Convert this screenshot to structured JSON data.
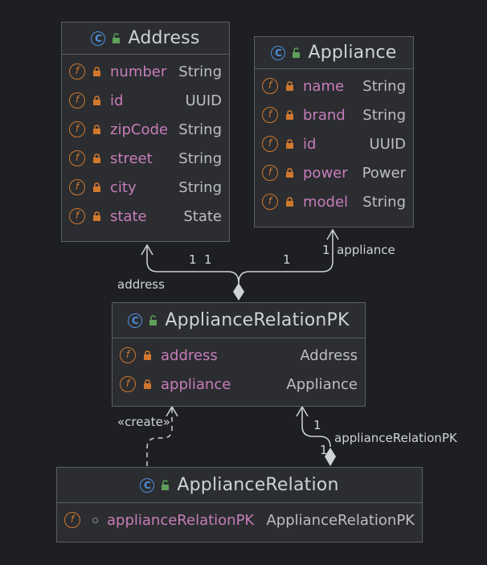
{
  "classes": {
    "address": {
      "name": "Address",
      "fields": [
        {
          "name": "number",
          "type": "String"
        },
        {
          "name": "id",
          "type": "UUID"
        },
        {
          "name": "zipCode",
          "type": "String"
        },
        {
          "name": "street",
          "type": "String"
        },
        {
          "name": "city",
          "type": "String"
        },
        {
          "name": "state",
          "type": "State"
        }
      ]
    },
    "appliance": {
      "name": "Appliance",
      "fields": [
        {
          "name": "name",
          "type": "String"
        },
        {
          "name": "brand",
          "type": "String"
        },
        {
          "name": "id",
          "type": "UUID"
        },
        {
          "name": "power",
          "type": "Power"
        },
        {
          "name": "model",
          "type": "String"
        }
      ]
    },
    "pk": {
      "name": "ApplianceRelationPK",
      "fields": [
        {
          "name": "address",
          "type": "Address"
        },
        {
          "name": "appliance",
          "type": "Appliance"
        }
      ]
    },
    "relation": {
      "name": "ApplianceRelation",
      "fields": [
        {
          "name": "applianceRelationPK",
          "type": "ApplianceRelationPK"
        }
      ]
    }
  },
  "edges": {
    "address_role": "address",
    "address_mult_a": "1",
    "address_mult_b": "1",
    "appliance_role": "appliance",
    "appliance_mult_a": "1",
    "appliance_mult_b": "1",
    "create_label": "«create»",
    "pk_role": "applianceRelationPK",
    "pk_mult_a": "1",
    "pk_mult_b": "1"
  },
  "icons": {
    "class_icon_letter": "C",
    "field_icon_letter": "f"
  },
  "colors": {
    "background": "#1e1f22",
    "box": "#2b2d30",
    "field_name": "#c77dbb",
    "type": "#bcbec4",
    "field_icon": "#d0782e",
    "class_icon": "#4f8fe0",
    "unlock_icon": "#5fa05a"
  }
}
